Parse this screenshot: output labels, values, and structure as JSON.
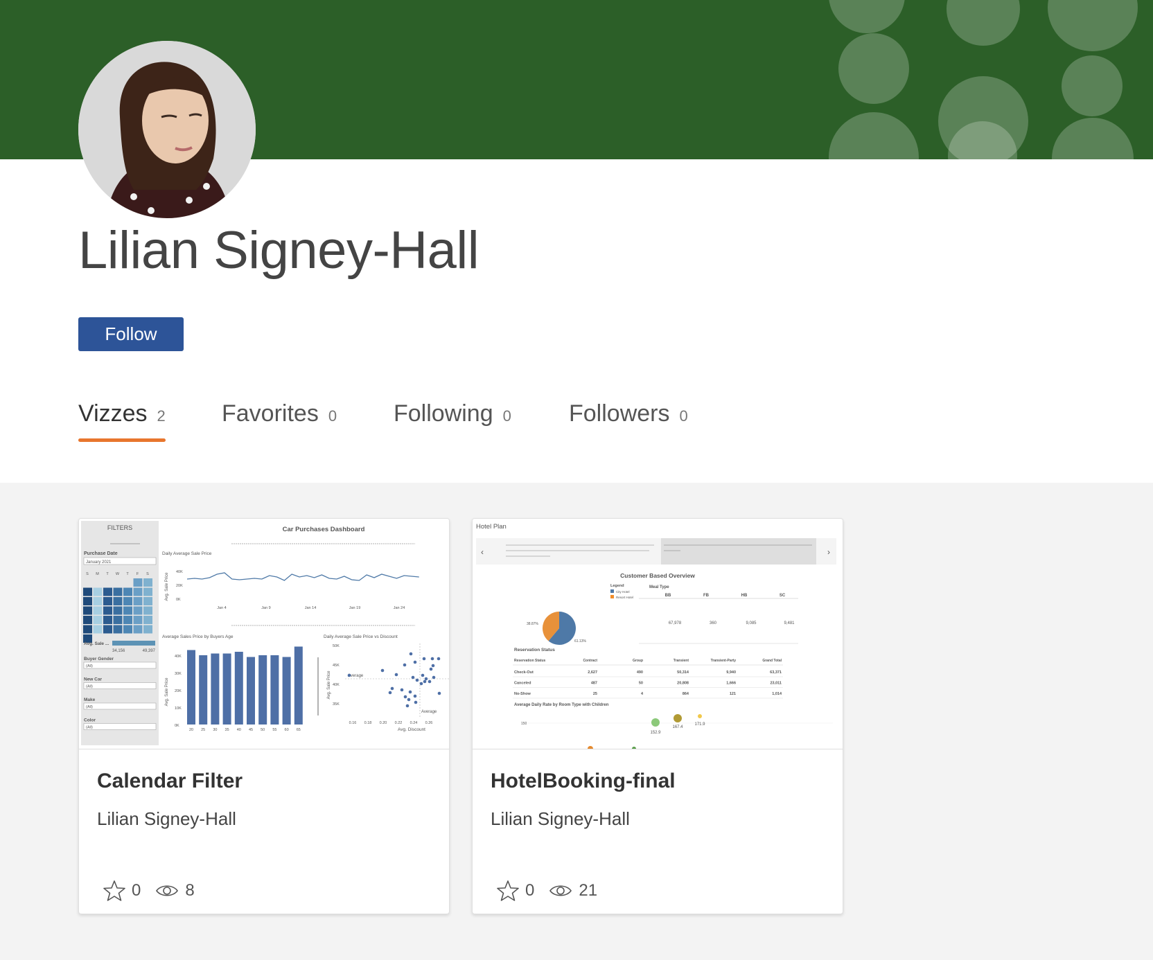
{
  "profile": {
    "name": "Lilian Signey-Hall",
    "follow_label": "Follow"
  },
  "colors": {
    "banner": "#2c5f28",
    "follow_button": "#2d5498",
    "tab_underline": "#e8762d"
  },
  "tabs": [
    {
      "label": "Vizzes",
      "count": "2",
      "active": true
    },
    {
      "label": "Favorites",
      "count": "0",
      "active": false
    },
    {
      "label": "Following",
      "count": "0",
      "active": false
    },
    {
      "label": "Followers",
      "count": "0",
      "active": false
    }
  ],
  "vizzes": [
    {
      "title": "Calendar Filter",
      "author": "Lilian Signey-Hall",
      "favorites": "0",
      "views": "8",
      "thumb": {
        "filters_label": "FILTERS",
        "dashboard_title": "Car Purchases Dashboard",
        "purchase_date_label": "Purchase Date",
        "purchase_date_value": "January 2021",
        "weekdays": [
          "S",
          "M",
          "T",
          "W",
          "T",
          "F",
          "S"
        ],
        "avg_sale_label": "Avg. Sale ...",
        "avg_sale_min": "34,156",
        "avg_sale_max": "49,397",
        "filters": [
          {
            "label": "Buyer Gender",
            "value": "(All)"
          },
          {
            "label": "New Car",
            "value": "(All)"
          },
          {
            "label": "Make",
            "value": "(All)"
          },
          {
            "label": "Color",
            "value": "(All)"
          }
        ],
        "line_title": "Daily Average Sale Price",
        "line_ylabel": "Avg. Sale Price",
        "line_yticks": [
          "40K",
          "20K",
          "0K"
        ],
        "line_xticks": [
          "Jan 4",
          "Jan 9",
          "Jan 14",
          "Jan 19",
          "Jan 24"
        ],
        "bar_title": "Average Sales Price by Buyers Age",
        "bar_ylabel": "Avg. Sale Price",
        "bar_yticks": [
          "40K",
          "30K",
          "20K",
          "10K",
          "0K"
        ],
        "bar_xticks": [
          "20",
          "25",
          "30",
          "35",
          "40",
          "45",
          "50",
          "55",
          "60",
          "65"
        ],
        "scatter_title": "Daily Average Sale Price vs Discount",
        "scatter_ylabel": "Avg. Sale Price",
        "scatter_yticks": [
          "50K",
          "45K",
          "40K",
          "35K"
        ],
        "scatter_xticks": [
          "0.16",
          "0.18",
          "0.20",
          "0.22",
          "0.24",
          "0.26"
        ],
        "scatter_xlabel": "Avg. Discount",
        "average_label": "Average"
      }
    },
    {
      "title": "HotelBooking-final",
      "author": "Lilian Signey-Hall",
      "favorites": "0",
      "views": "21",
      "thumb": {
        "header": "Hotel Plan",
        "overview_title": "Customer Based Overview",
        "legend_label": "Legend",
        "legend_items": [
          "City Hotel",
          "Resort Hotel"
        ],
        "meal_type_label": "Meal Type",
        "meal_types": [
          "BB",
          "FB",
          "HB",
          "SC"
        ],
        "meal_values": [
          "67,978",
          "360",
          "9,085",
          "9,481"
        ],
        "pie_labels": [
          "38.87%",
          "61.13%"
        ],
        "reservation_title": "Reservation Status",
        "table_headers": [
          "Reservation Status",
          "Contract",
          "Group",
          "Transient",
          "Transient-Party",
          "Grand Total"
        ],
        "table_rows": [
          [
            "Check-Out",
            "2,627",
            "490",
            "50,314",
            "9,940",
            "63,371"
          ],
          [
            "Canceled",
            "487",
            "50",
            "20,808",
            "1,666",
            "23,011"
          ],
          [
            "No-Show",
            "25",
            "4",
            "864",
            "121",
            "1,014"
          ]
        ],
        "adr_title": "Average Daily Rate by Room Type with Children",
        "adr_labels": [
          "152.9",
          "167.4",
          "171.9"
        ]
      }
    }
  ]
}
